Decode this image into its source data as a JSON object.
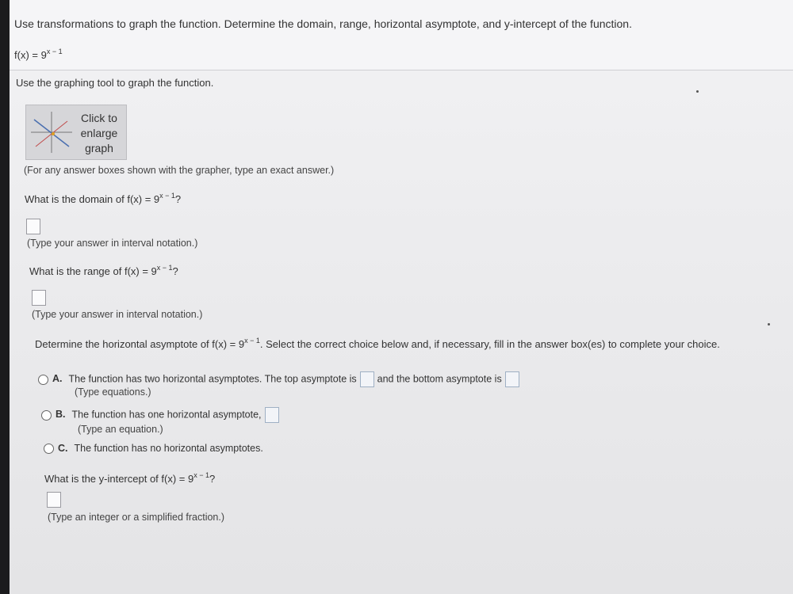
{
  "header": {
    "instruction": "Use transformations to graph the function. Determine the domain, range, horizontal asymptote, and y-intercept of the function.",
    "function_prefix": "f(x) = 9",
    "function_exponent": "x − 1"
  },
  "graph_tool": {
    "instruction": "Use the graphing tool to graph the function.",
    "button_line1": "Click to",
    "button_line2": "enlarge",
    "button_line3": "graph",
    "note": "(For any answer boxes shown with the grapher, type an exact answer.)"
  },
  "domain": {
    "question_prefix": "What is the domain of f(x) = 9",
    "question_exponent": "x − 1",
    "question_suffix": "?",
    "hint": "(Type your answer in interval notation.)"
  },
  "range": {
    "question_prefix": "What is the range of f(x) = 9",
    "question_exponent": "x − 1",
    "question_suffix": "?",
    "hint": "(Type your answer in interval notation.)"
  },
  "asymptote": {
    "question_prefix": "Determine the horizontal asymptote of f(x) = 9",
    "question_exponent": "x − 1",
    "question_suffix": ". Select the correct choice below and, if necessary, fill in the answer box(es) to complete your choice.",
    "choice_a_letter": "A.",
    "choice_a_text1": "The function has two horizontal asymptotes. The top asymptote is",
    "choice_a_text2": "and the bottom asymptote is",
    "choice_a_hint": "(Type equations.)",
    "choice_b_letter": "B.",
    "choice_b_text": "The function has one horizontal asymptote,",
    "choice_b_hint": "(Type an equation.)",
    "choice_c_letter": "C.",
    "choice_c_text": "The function has no horizontal asymptotes."
  },
  "yint": {
    "question_prefix": "What is the y-intercept of f(x) = 9",
    "question_exponent": "x − 1",
    "question_suffix": "?",
    "hint": "(Type an integer or a simplified fraction.)"
  }
}
